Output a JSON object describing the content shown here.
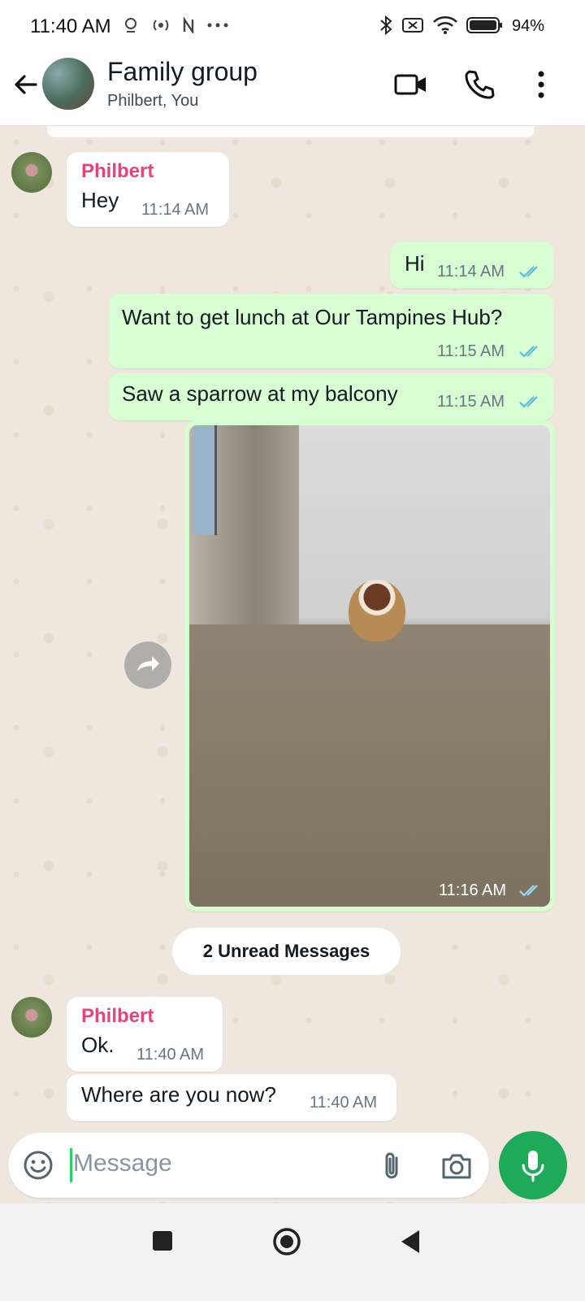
{
  "status_bar": {
    "time": "11:40 AM",
    "left_icons": [
      "data-saver-icon",
      "hotspot-icon",
      "n-icon",
      "more-dots-icon"
    ],
    "right_icons": [
      "bluetooth-icon",
      "no-sim-icon",
      "wifi-icon",
      "battery-icon"
    ],
    "battery": "94%"
  },
  "header": {
    "title": "Family group",
    "subtitle": "Philbert, You",
    "icons": [
      "back-arrow-icon",
      "video-call-icon",
      "voice-call-icon",
      "kebab-menu-icon"
    ]
  },
  "messages": [
    {
      "direction": "in",
      "sender": "Philbert",
      "text": "Hey",
      "time": "11:14 AM"
    },
    {
      "direction": "out",
      "text": "Hi",
      "time": "11:14 AM",
      "status": "read"
    },
    {
      "direction": "out",
      "text": "Want to get lunch at Our Tampines Hub?",
      "time": "11:15 AM",
      "status": "read"
    },
    {
      "direction": "out",
      "text": "Saw a sparrow at my balcony",
      "time": "11:15 AM",
      "status": "read"
    },
    {
      "direction": "out",
      "type": "image",
      "time": "11:16 AM",
      "status": "read"
    },
    {
      "direction": "in",
      "sender": "Philbert",
      "text": "Ok.",
      "time": "11:40 AM"
    },
    {
      "direction": "in",
      "text": "Where are you now?",
      "time": "11:40 AM"
    }
  ],
  "unread_label": "2 Unread Messages",
  "composer": {
    "placeholder": "Message",
    "icons": [
      "emoji-icon",
      "attach-icon",
      "camera-icon",
      "mic-icon"
    ]
  },
  "colors": {
    "incoming_bubble": "#ffffff",
    "outgoing_bubble": "#d9fdd3",
    "sender_name": "#e0467c",
    "read_ticks": "#53bdeb",
    "mic_button": "#1faa59",
    "chat_background": "#efe7dd"
  }
}
